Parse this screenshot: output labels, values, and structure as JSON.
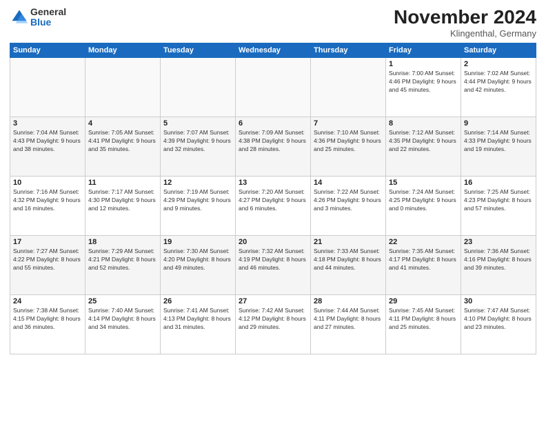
{
  "header": {
    "logo_general": "General",
    "logo_blue": "Blue",
    "month_title": "November 2024",
    "location": "Klingenthal, Germany"
  },
  "weekdays": [
    "Sunday",
    "Monday",
    "Tuesday",
    "Wednesday",
    "Thursday",
    "Friday",
    "Saturday"
  ],
  "weeks": [
    [
      {
        "day": "",
        "info": ""
      },
      {
        "day": "",
        "info": ""
      },
      {
        "day": "",
        "info": ""
      },
      {
        "day": "",
        "info": ""
      },
      {
        "day": "",
        "info": ""
      },
      {
        "day": "1",
        "info": "Sunrise: 7:00 AM\nSunset: 4:46 PM\nDaylight: 9 hours\nand 45 minutes."
      },
      {
        "day": "2",
        "info": "Sunrise: 7:02 AM\nSunset: 4:44 PM\nDaylight: 9 hours\nand 42 minutes."
      }
    ],
    [
      {
        "day": "3",
        "info": "Sunrise: 7:04 AM\nSunset: 4:43 PM\nDaylight: 9 hours\nand 38 minutes."
      },
      {
        "day": "4",
        "info": "Sunrise: 7:05 AM\nSunset: 4:41 PM\nDaylight: 9 hours\nand 35 minutes."
      },
      {
        "day": "5",
        "info": "Sunrise: 7:07 AM\nSunset: 4:39 PM\nDaylight: 9 hours\nand 32 minutes."
      },
      {
        "day": "6",
        "info": "Sunrise: 7:09 AM\nSunset: 4:38 PM\nDaylight: 9 hours\nand 28 minutes."
      },
      {
        "day": "7",
        "info": "Sunrise: 7:10 AM\nSunset: 4:36 PM\nDaylight: 9 hours\nand 25 minutes."
      },
      {
        "day": "8",
        "info": "Sunrise: 7:12 AM\nSunset: 4:35 PM\nDaylight: 9 hours\nand 22 minutes."
      },
      {
        "day": "9",
        "info": "Sunrise: 7:14 AM\nSunset: 4:33 PM\nDaylight: 9 hours\nand 19 minutes."
      }
    ],
    [
      {
        "day": "10",
        "info": "Sunrise: 7:16 AM\nSunset: 4:32 PM\nDaylight: 9 hours\nand 16 minutes."
      },
      {
        "day": "11",
        "info": "Sunrise: 7:17 AM\nSunset: 4:30 PM\nDaylight: 9 hours\nand 12 minutes."
      },
      {
        "day": "12",
        "info": "Sunrise: 7:19 AM\nSunset: 4:29 PM\nDaylight: 9 hours\nand 9 minutes."
      },
      {
        "day": "13",
        "info": "Sunrise: 7:20 AM\nSunset: 4:27 PM\nDaylight: 9 hours\nand 6 minutes."
      },
      {
        "day": "14",
        "info": "Sunrise: 7:22 AM\nSunset: 4:26 PM\nDaylight: 9 hours\nand 3 minutes."
      },
      {
        "day": "15",
        "info": "Sunrise: 7:24 AM\nSunset: 4:25 PM\nDaylight: 9 hours\nand 0 minutes."
      },
      {
        "day": "16",
        "info": "Sunrise: 7:25 AM\nSunset: 4:23 PM\nDaylight: 8 hours\nand 57 minutes."
      }
    ],
    [
      {
        "day": "17",
        "info": "Sunrise: 7:27 AM\nSunset: 4:22 PM\nDaylight: 8 hours\nand 55 minutes."
      },
      {
        "day": "18",
        "info": "Sunrise: 7:29 AM\nSunset: 4:21 PM\nDaylight: 8 hours\nand 52 minutes."
      },
      {
        "day": "19",
        "info": "Sunrise: 7:30 AM\nSunset: 4:20 PM\nDaylight: 8 hours\nand 49 minutes."
      },
      {
        "day": "20",
        "info": "Sunrise: 7:32 AM\nSunset: 4:19 PM\nDaylight: 8 hours\nand 46 minutes."
      },
      {
        "day": "21",
        "info": "Sunrise: 7:33 AM\nSunset: 4:18 PM\nDaylight: 8 hours\nand 44 minutes."
      },
      {
        "day": "22",
        "info": "Sunrise: 7:35 AM\nSunset: 4:17 PM\nDaylight: 8 hours\nand 41 minutes."
      },
      {
        "day": "23",
        "info": "Sunrise: 7:36 AM\nSunset: 4:16 PM\nDaylight: 8 hours\nand 39 minutes."
      }
    ],
    [
      {
        "day": "24",
        "info": "Sunrise: 7:38 AM\nSunset: 4:15 PM\nDaylight: 8 hours\nand 36 minutes."
      },
      {
        "day": "25",
        "info": "Sunrise: 7:40 AM\nSunset: 4:14 PM\nDaylight: 8 hours\nand 34 minutes."
      },
      {
        "day": "26",
        "info": "Sunrise: 7:41 AM\nSunset: 4:13 PM\nDaylight: 8 hours\nand 31 minutes."
      },
      {
        "day": "27",
        "info": "Sunrise: 7:42 AM\nSunset: 4:12 PM\nDaylight: 8 hours\nand 29 minutes."
      },
      {
        "day": "28",
        "info": "Sunrise: 7:44 AM\nSunset: 4:11 PM\nDaylight: 8 hours\nand 27 minutes."
      },
      {
        "day": "29",
        "info": "Sunrise: 7:45 AM\nSunset: 4:11 PM\nDaylight: 8 hours\nand 25 minutes."
      },
      {
        "day": "30",
        "info": "Sunrise: 7:47 AM\nSunset: 4:10 PM\nDaylight: 8 hours\nand 23 minutes."
      }
    ]
  ]
}
